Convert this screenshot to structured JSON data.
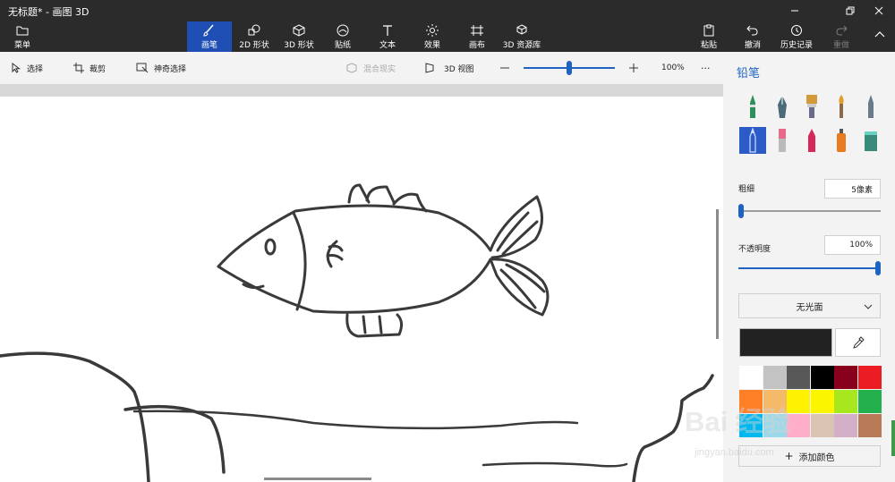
{
  "window": {
    "title": "无标题* - 画图 3D",
    "min_icon": "minimize-icon",
    "max_icon": "restore-icon",
    "close_icon": "close-icon"
  },
  "ribbon": {
    "menu_label": "菜单",
    "tabs": [
      {
        "label": "画笔",
        "icon": "brush-icon",
        "active": true
      },
      {
        "label": "2D 形状",
        "icon": "2d-shapes-icon"
      },
      {
        "label": "3D 形状",
        "icon": "3d-shapes-icon"
      },
      {
        "label": "贴纸",
        "icon": "sticker-icon"
      },
      {
        "label": "文本",
        "icon": "text-icon"
      },
      {
        "label": "效果",
        "icon": "effects-icon"
      },
      {
        "label": "画布",
        "icon": "canvas-icon"
      },
      {
        "label": "3D 资源库",
        "icon": "3d-library-icon"
      }
    ],
    "paste_label": "粘贴",
    "undo_label": "撤消",
    "history_label": "历史记录",
    "redo_label": "重做"
  },
  "toolbar": {
    "select_label": "选择",
    "crop_label": "裁剪",
    "magic_select_label": "神奇选择",
    "mixed_reality_label": "混合现实",
    "view3d_label": "3D 视图",
    "zoom_level": "100%",
    "zoom_fraction": 0.5,
    "more_label": "···"
  },
  "panel": {
    "title": "铅笔",
    "tools": [
      {
        "name": "marker-icon",
        "color": "#2e8f5a"
      },
      {
        "name": "calligraphy-pen-icon",
        "color": "#4a6b7a"
      },
      {
        "name": "oil-brush-icon",
        "color": "#d49a3a"
      },
      {
        "name": "watercolor-icon",
        "color": "#e0a030"
      },
      {
        "name": "pixel-pen-icon",
        "color": "#6b7a8a"
      },
      {
        "name": "pencil-icon",
        "color": "#8fb0ff",
        "active": true
      },
      {
        "name": "eraser-icon",
        "color": "#e86a8a"
      },
      {
        "name": "crayon-icon",
        "color": "#d42a5a"
      },
      {
        "name": "spray-can-icon",
        "color": "#e87a20"
      },
      {
        "name": "fill-icon",
        "color": "#3a8a7a"
      }
    ],
    "thickness_label": "粗细",
    "thickness_value": "5像素",
    "thickness_fraction": 0.02,
    "opacity_label": "不透明度",
    "opacity_value": "100%",
    "opacity_fraction": 1.0,
    "finish_label": "无光面",
    "selected_color": "#222222",
    "swatches": [
      "#ffffff",
      "#c3c3c3",
      "#585858",
      "#000000",
      "#88001b",
      "#ec1c24",
      "#ff7f27",
      "#f5b96a",
      "#fff200",
      "#fbf500",
      "#a8e61d",
      "#22b14c",
      "#00b7ef",
      "#99d9ea",
      "#ffaec9",
      "#d9c4b4",
      "#d4b0c8",
      "#b97a57"
    ],
    "add_color_label": "添加颜色"
  },
  "watermark": {
    "text": "Bai 经验",
    "url": "jingyan.baidu.com"
  }
}
